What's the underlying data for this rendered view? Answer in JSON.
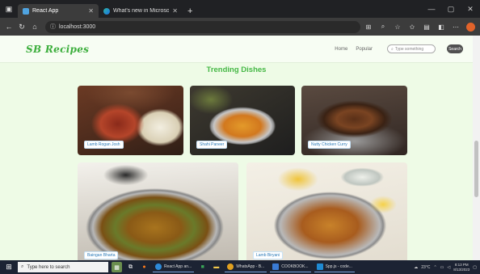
{
  "browser": {
    "tabs": [
      {
        "label": "React App",
        "active": true
      },
      {
        "label": "What's new in Microsoft Edge",
        "active": false
      }
    ],
    "new_tab_glyph": "+",
    "url": "localhost:3000"
  },
  "site": {
    "logo": "SB Recipes",
    "nav": {
      "home": "Home",
      "popular": "Popular"
    },
    "search": {
      "placeholder": "Type something",
      "button": "Search"
    },
    "heading": "Trending Dishes",
    "dishes": [
      {
        "name": "Lamb Rogan Josh"
      },
      {
        "name": "Shahi Paneer"
      },
      {
        "name": "Nutty Chicken Curry"
      },
      {
        "name": "Baingan Bharta"
      },
      {
        "name": "Lamb Biryani"
      }
    ]
  },
  "taskbar": {
    "search_placeholder": "Type here to search",
    "apps": [
      {
        "label": "React App an...",
        "color": "#2d8ad8"
      },
      {
        "label": "WhatsApp - B...",
        "color": "#25d366"
      },
      {
        "label": "COOKBOOK...",
        "color": "#3a7bd5"
      },
      {
        "label": "Spp.js - code...",
        "color": "#1f8ad2"
      }
    ],
    "temperature": "23°C",
    "time": "8:13 PM",
    "date": "8/13/2023"
  }
}
